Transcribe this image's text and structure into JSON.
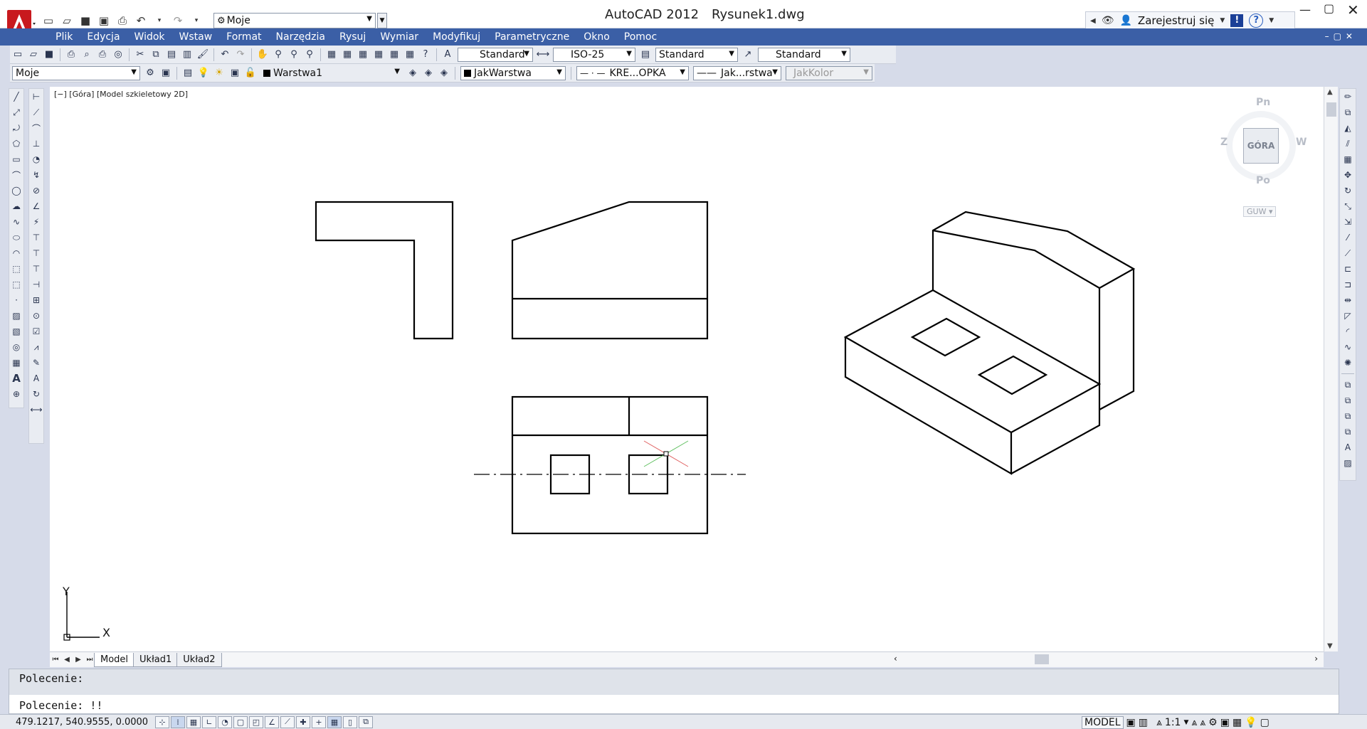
{
  "title_bar": {
    "app_title": "AutoCAD 2012",
    "doc_title": "Rysunek1.dwg",
    "workspace": "Moje",
    "user_label": "Zarejestruj się"
  },
  "menu": [
    "Plik",
    "Edycja",
    "Widok",
    "Wstaw",
    "Format",
    "Narzędzia",
    "Rysuj",
    "Wymiar",
    "Modyfikuj",
    "Parametryczne",
    "Okno",
    "Pomoc"
  ],
  "toolbar_styles": {
    "text_style": "Standard",
    "dim_style": "ISO-25",
    "table_style": "Standard",
    "mleader_style": "Standard"
  },
  "toolbar_layers": {
    "workspace": "Moje",
    "layer": "Warstwa1",
    "color": "JakWarstwa",
    "linetype": "KRE...OPKA",
    "lineweight": "Jak...rstwa",
    "plotstyle": "JakKolor"
  },
  "viewport_label": "[−] [Góra] [Model szkieletowy 2D]",
  "viewcube": {
    "face": "GÓRA",
    "north": "Pn",
    "south": "Po",
    "west": "Z",
    "east": "W",
    "wcs": "GUW"
  },
  "ucs": {
    "x": "X",
    "y": "Y"
  },
  "tabs": [
    "Model",
    "Układ1",
    "Układ2"
  ],
  "command_line": {
    "history": "Polecenie:",
    "current": "Polecenie: !!"
  },
  "status": {
    "coords": "479.1217, 540.9555, 0.0000",
    "space": "MODEL",
    "scale": "1:1"
  },
  "colors": {
    "menubar": "#3b5fa6",
    "canvas": "#ffffff",
    "accent_red": "#c8191e"
  }
}
